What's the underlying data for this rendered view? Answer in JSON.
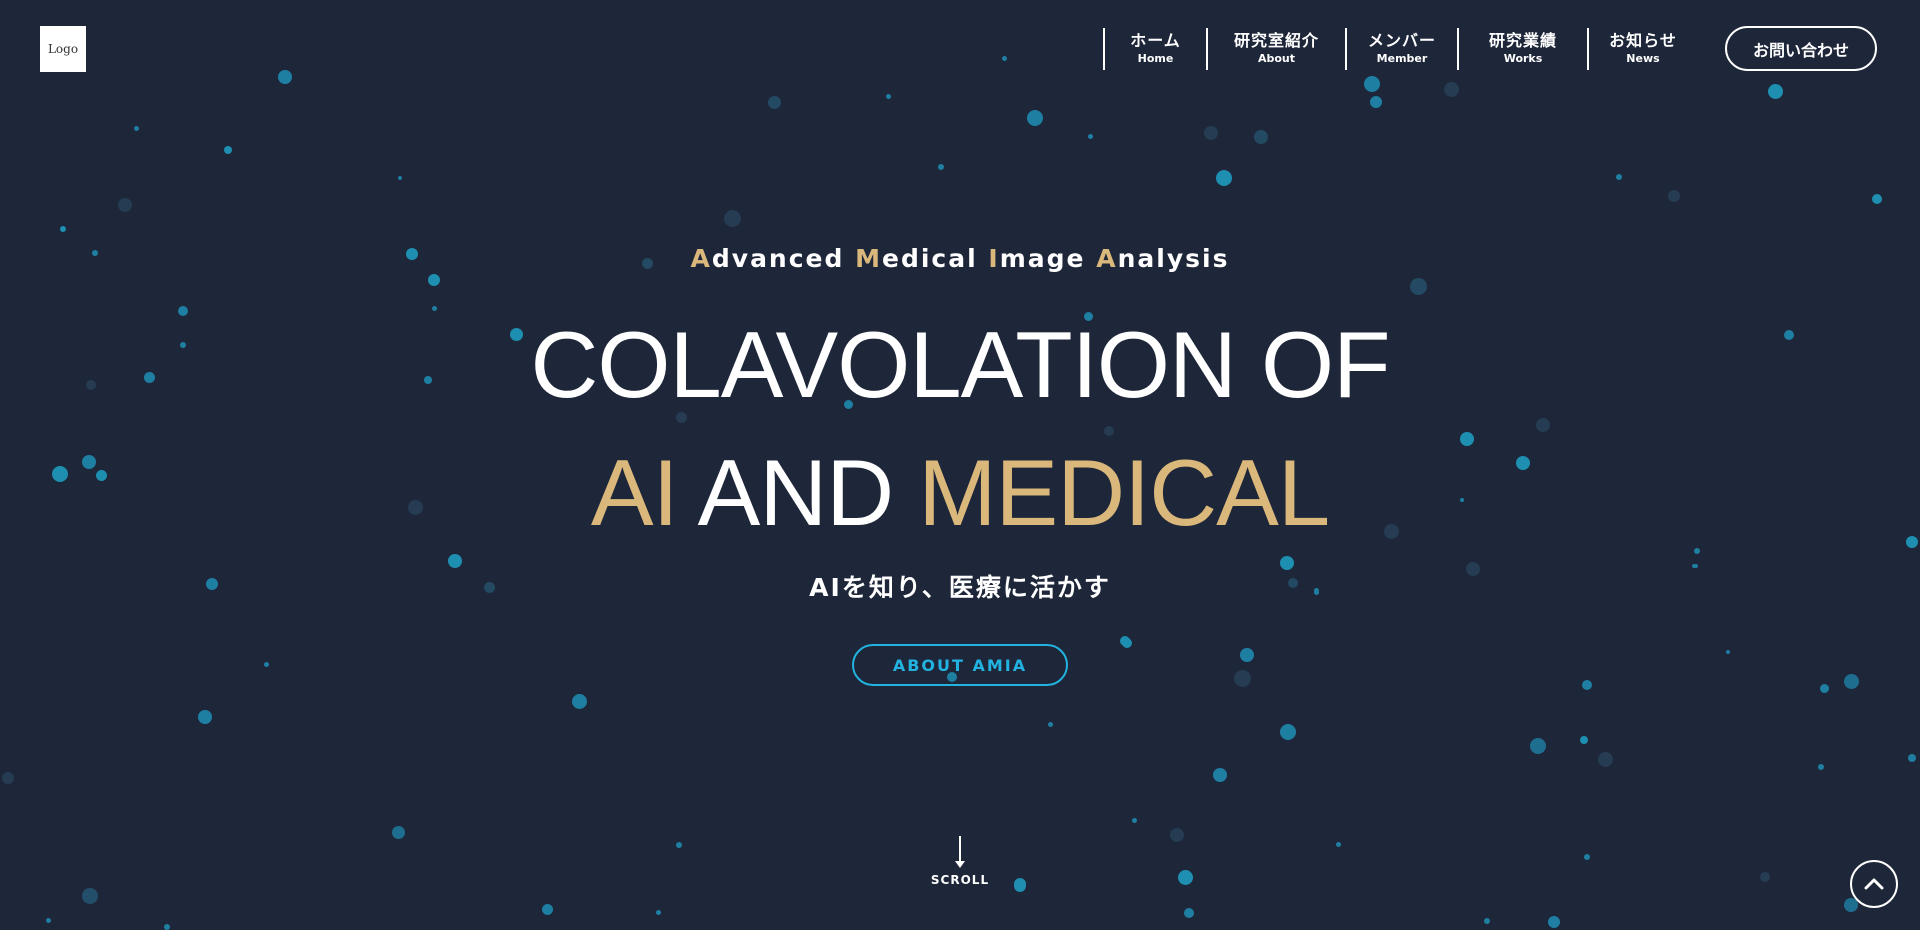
{
  "header": {
    "logo_text": "Logo",
    "nav": [
      {
        "jp": "ホーム",
        "en": "Home"
      },
      {
        "jp": "研究室紹介",
        "en": "About"
      },
      {
        "jp": "メンバー",
        "en": "Member"
      },
      {
        "jp": "研究業績",
        "en": "Works"
      },
      {
        "jp": "お知らせ",
        "en": "News"
      }
    ],
    "contact_label": "お問い合わせ"
  },
  "hero": {
    "tagline_words": [
      {
        "initial": "A",
        "rest": "dvanced"
      },
      {
        "initial": "M",
        "rest": "edical"
      },
      {
        "initial": "I",
        "rest": "mage"
      },
      {
        "initial": "A",
        "rest": "nalysis"
      }
    ],
    "headline_line1": "COLAVOLATION OF",
    "headline_line2": {
      "part1": "AI",
      "part2": "AND",
      "part3": "MEDICAL"
    },
    "subtitle": "AIを知り、医療に活かす",
    "cta_label": "ABOUT AMIA",
    "scroll_label": "SCROLL"
  },
  "icons": {
    "scroll_arrow": "arrow-down-icon",
    "back_to_top": "chevron-up-icon"
  },
  "colors": {
    "background": "#1e2639",
    "accent_gold": "#dab87c",
    "accent_cyan": "#22b3e0",
    "text": "#ffffff",
    "particle_bright": "#1e8fb0",
    "particle_dim": "#23506a"
  }
}
